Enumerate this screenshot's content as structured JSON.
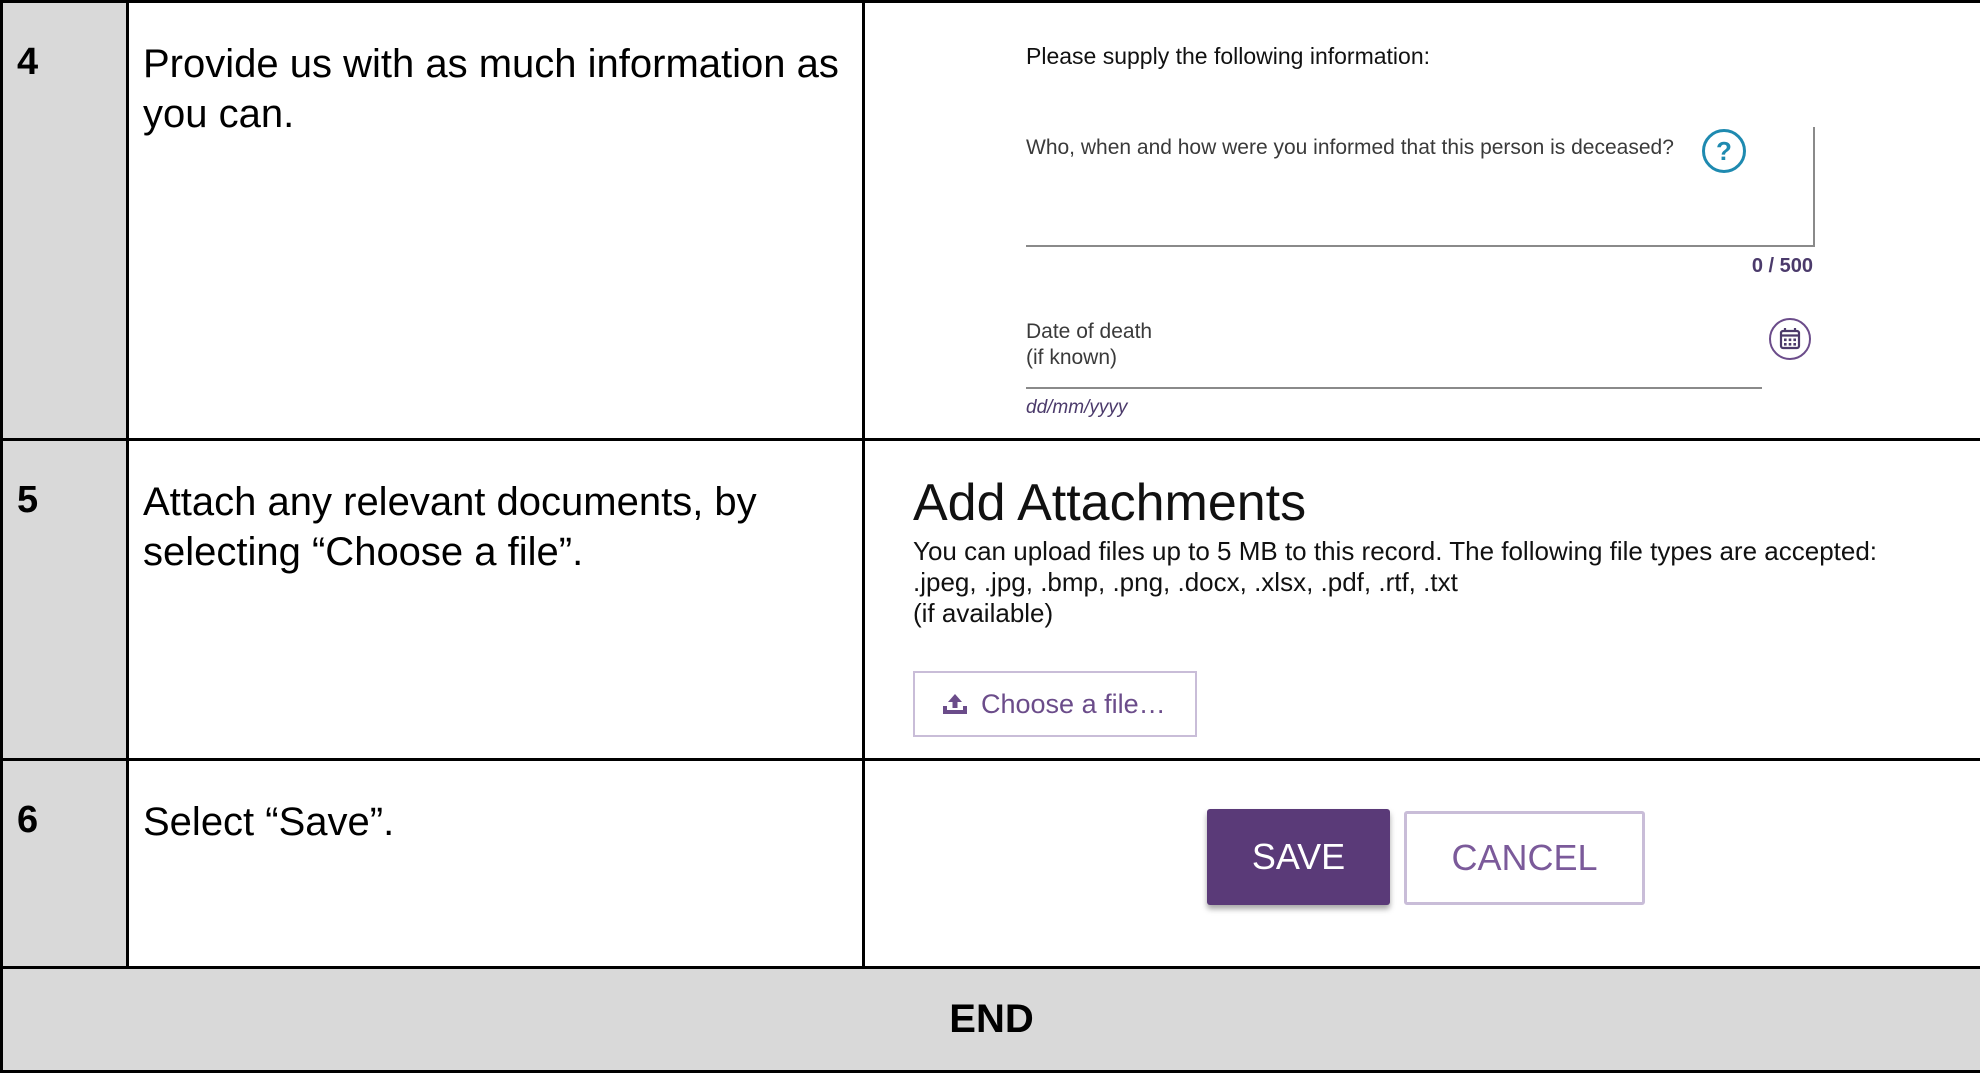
{
  "rows": [
    {
      "num": "4",
      "instruction": "Provide us with as much information as you can."
    },
    {
      "num": "5",
      "instruction": "Attach any relevant documents, by selecting “Choose a file”."
    },
    {
      "num": "6",
      "instruction": "Select “Save”."
    }
  ],
  "form": {
    "intro": "Please supply the following information:",
    "question": "Who, when and how were you informed that this person is deceased?",
    "question_value": "",
    "help_symbol": "?",
    "counter": "0 / 500",
    "date_label": "Date of death",
    "date_sublabel": "(if known)",
    "date_value": "",
    "date_format": "dd/mm/yyyy"
  },
  "attachments": {
    "title": "Add Attachments",
    "description_line1": "You can upload files up to 5 MB to this record. The following file types are accepted:",
    "description_line2": ".jpeg, .jpg, .bmp, .png, .docx, .xlsx, .pdf, .rtf, .txt",
    "description_line3": "(if available)",
    "choose_label": "Choose a file…"
  },
  "actions": {
    "save_label": "SAVE",
    "cancel_label": "CANCEL"
  },
  "footer": {
    "end_label": "END"
  },
  "colors": {
    "accent": "#5a3a78",
    "help": "#1e8ab0",
    "cell_gray": "#d9d9d9"
  },
  "icons": {
    "help": "help-icon",
    "calendar": "calendar-icon",
    "upload": "upload-icon"
  }
}
